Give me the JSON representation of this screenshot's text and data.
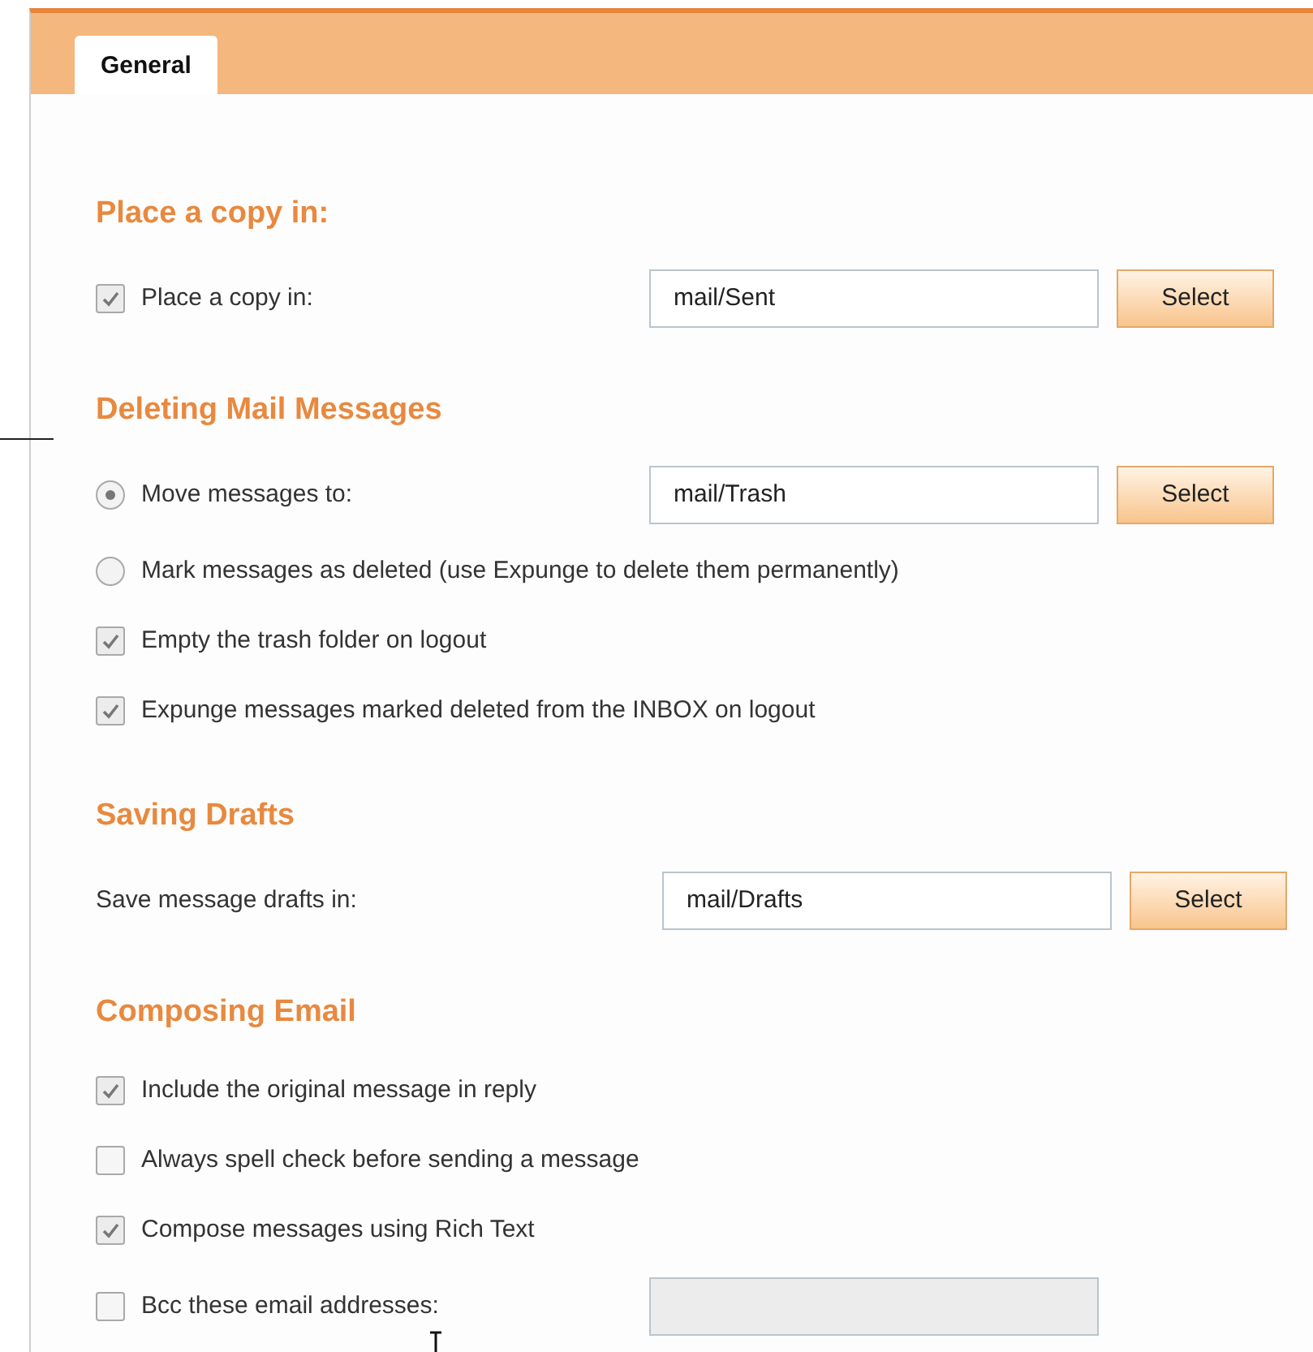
{
  "tabs": [
    {
      "label": "General",
      "selected": true
    }
  ],
  "sections": [
    {
      "heading": "Place a copy in:",
      "rows": [
        {
          "kind": "checkbox",
          "label": "Place a copy in:",
          "checked": true,
          "field": {
            "value": "mail/Sent",
            "disabled": false
          },
          "button": "Select"
        }
      ]
    },
    {
      "heading": "Deleting Mail Messages",
      "rows": [
        {
          "kind": "radio",
          "label": "Move messages to:",
          "selected": true,
          "field": {
            "value": "mail/Trash",
            "disabled": false
          },
          "button": "Select"
        },
        {
          "kind": "radio",
          "label": "Mark messages as deleted (use Expunge to delete them permanently)",
          "selected": false
        },
        {
          "kind": "checkbox",
          "label": "Empty the trash folder on logout",
          "checked": true
        },
        {
          "kind": "checkbox",
          "label": "Expunge messages marked deleted from the INBOX on logout",
          "checked": true
        }
      ]
    },
    {
      "heading": "Saving Drafts",
      "rows": [
        {
          "kind": "plain",
          "label": "Save message drafts in:",
          "field": {
            "value": "mail/Drafts",
            "disabled": false
          },
          "button": "Select"
        }
      ]
    },
    {
      "heading": "Composing Email",
      "rows": [
        {
          "kind": "checkbox",
          "label": "Include the original message in reply",
          "checked": true
        },
        {
          "kind": "checkbox",
          "label": "Always spell check before sending a message",
          "checked": false
        },
        {
          "kind": "checkbox",
          "label": "Compose messages using Rich Text",
          "checked": true
        },
        {
          "kind": "checkbox",
          "label": "Bcc these email addresses:",
          "checked": false,
          "field": {
            "disabled": true
          }
        }
      ]
    }
  ]
}
